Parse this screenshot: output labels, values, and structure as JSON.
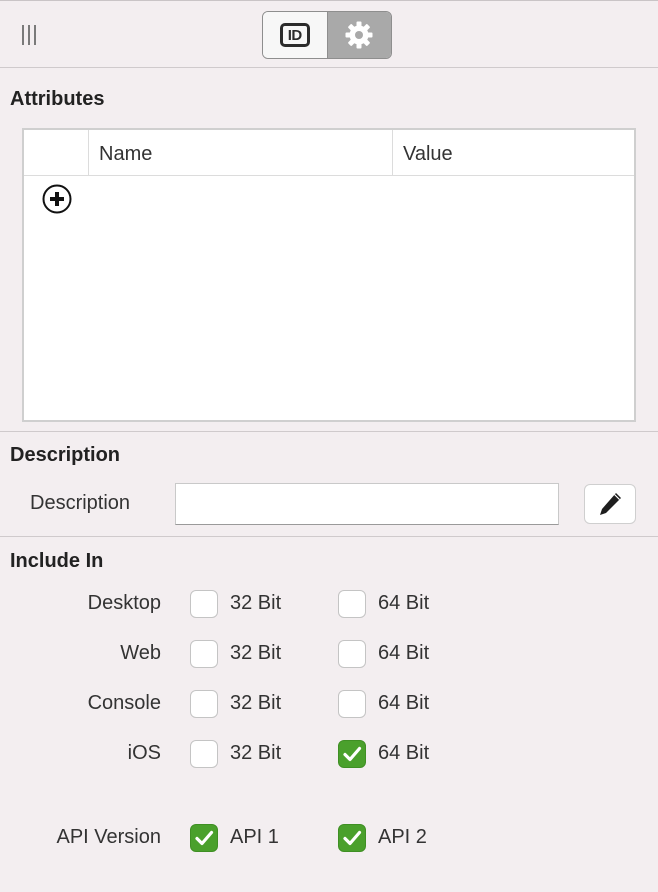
{
  "toolbar": {
    "grip_icon": "vertical-grip-icon",
    "id_button_icon": "id-card-icon",
    "id_button_text": "ID",
    "settings_button_icon": "gear-icon"
  },
  "attributes": {
    "title": "Attributes",
    "columns": [
      "Name",
      "Value"
    ],
    "add_icon": "plus-circle-icon",
    "rows": []
  },
  "description": {
    "title": "Description",
    "label": "Description",
    "value": "",
    "edit_icon": "pencil-icon"
  },
  "include_in": {
    "title": "Include In",
    "platforms": [
      {
        "label": "Desktop",
        "bit32_label": "32 Bit",
        "bit32": false,
        "bit64_label": "64 Bit",
        "bit64": false
      },
      {
        "label": "Web",
        "bit32_label": "32 Bit",
        "bit32": false,
        "bit64_label": "64 Bit",
        "bit64": false
      },
      {
        "label": "Console",
        "bit32_label": "32 Bit",
        "bit32": false,
        "bit64_label": "64 Bit",
        "bit64": false
      },
      {
        "label": "iOS",
        "bit32_label": "32 Bit",
        "bit32": false,
        "bit64_label": "64 Bit",
        "bit64": true
      }
    ],
    "api": {
      "label": "API Version",
      "api1_label": "API 1",
      "api1": true,
      "api2_label": "API 2",
      "api2": true
    }
  },
  "colors": {
    "checked": "#4aa02c",
    "background": "#f3eef0"
  }
}
